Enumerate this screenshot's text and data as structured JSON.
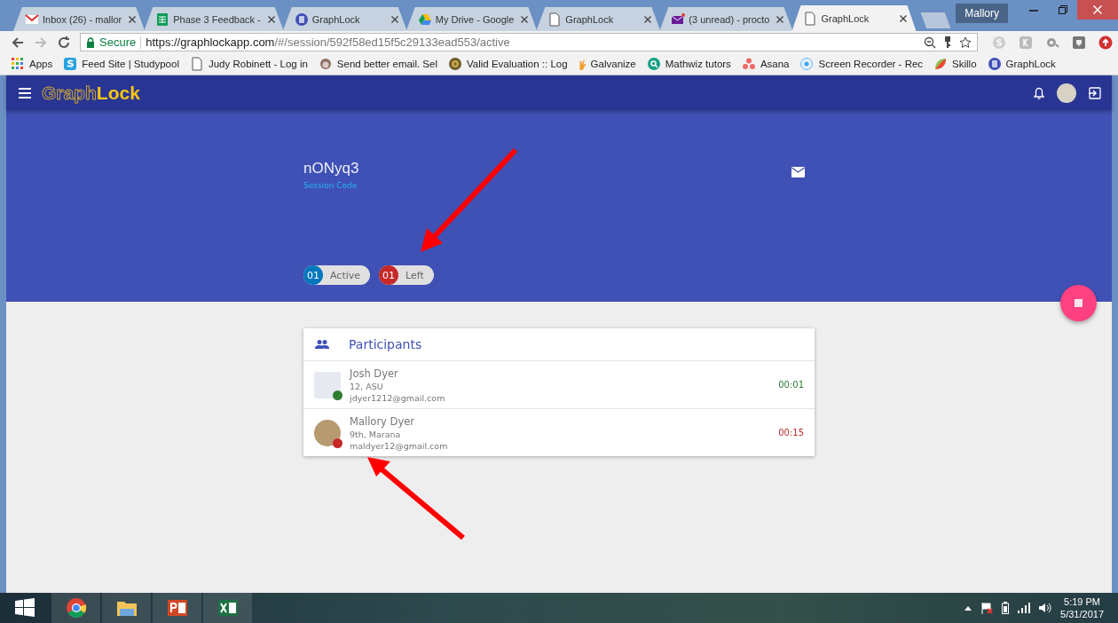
{
  "browser": {
    "tabs": [
      {
        "label": "Inbox (26) - mallor",
        "kind": "gmail",
        "selected": false
      },
      {
        "label": "Phase 3 Feedback -",
        "kind": "sheets",
        "selected": false
      },
      {
        "label": "GraphLock",
        "kind": "app",
        "selected": false
      },
      {
        "label": "My Drive - Google",
        "kind": "drive",
        "selected": false
      },
      {
        "label": "GraphLock",
        "kind": "page",
        "selected": false
      },
      {
        "label": "(3 unread) - procto",
        "kind": "mail",
        "selected": false
      },
      {
        "label": "GraphLock",
        "kind": "page",
        "selected": true
      }
    ],
    "profile": "Mallory",
    "address": {
      "secure_label": "Secure",
      "url_host": "https://graphlockapp.com",
      "url_path": "/#/session/592f58ed15f5c29133ead553/active"
    },
    "bookmarks": [
      {
        "label": "Apps",
        "kind": "apps"
      },
      {
        "label": "Feed Site | Studypool",
        "kind": "studypool"
      },
      {
        "label": "Judy Robinett - Log in",
        "kind": "page"
      },
      {
        "label": "Send better email. Sel",
        "kind": "chimp"
      },
      {
        "label": "Valid Evaluation :: Log",
        "kind": "gear"
      },
      {
        "label": "Galvanize",
        "kind": "hand"
      },
      {
        "label": "Mathwiz tutors",
        "kind": "search"
      },
      {
        "label": "Asana",
        "kind": "asana"
      },
      {
        "label": "Screen Recorder - Rec",
        "kind": "record"
      },
      {
        "label": "Skillo",
        "kind": "skillo"
      },
      {
        "label": "GraphLock",
        "kind": "app"
      }
    ]
  },
  "app": {
    "logo_part1": "Graph",
    "logo_part2": "Lock",
    "session": {
      "code": "nONyq3",
      "code_label": "Session Code",
      "chips": [
        {
          "count": "01",
          "label": "Active",
          "color": "#0277bd"
        },
        {
          "count": "01",
          "label": "Left",
          "color": "#c62828"
        }
      ]
    },
    "participants": {
      "title": "Participants",
      "rows": [
        {
          "name": "Josh Dyer",
          "detail": "12, ASU",
          "email": "jdyer1212@gmail.com",
          "time": "00:01",
          "color": "#2e7d32"
        },
        {
          "name": "Mallory Dyer",
          "detail": "9th, Marana",
          "email": "maldyer12@gmail.com",
          "time": "00:15",
          "color": "#c62828"
        }
      ]
    }
  },
  "taskbar": {
    "time": "5:19 PM",
    "date": "5/31/2017"
  }
}
